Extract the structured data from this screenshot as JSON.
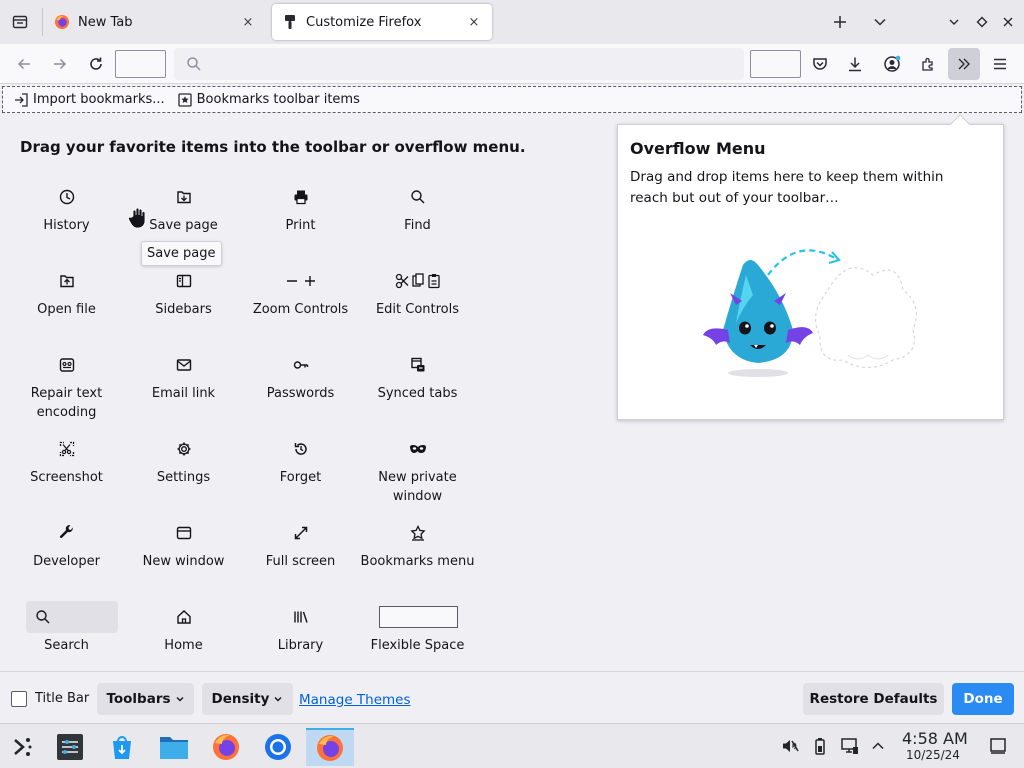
{
  "tabs": [
    {
      "label": "New Tab",
      "icon": "firefox-icon",
      "active": false
    },
    {
      "label": "Customize Firefox",
      "icon": "paintbrush-icon",
      "active": true
    }
  ],
  "tab_close_glyph": "×",
  "bookmarks_toolbar": {
    "import_label": "Import bookmarks...",
    "items_label": "Bookmarks toolbar items"
  },
  "palette": {
    "title": "Drag your favorite items into the toolbar or overflow menu.",
    "items": [
      {
        "label": "History",
        "icon": "clock-icon"
      },
      {
        "label": "Save page",
        "icon": "save-page-icon"
      },
      {
        "label": "Print",
        "icon": "printer-icon"
      },
      {
        "label": "Find",
        "icon": "magnifier-icon"
      },
      {
        "label": "Open file",
        "icon": "open-file-icon"
      },
      {
        "label": "Sidebars",
        "icon": "sidebar-icon"
      },
      {
        "label": "Zoom Controls",
        "icon": "zoom-icon"
      },
      {
        "label": "Edit Controls",
        "icon": "edit-controls-icon"
      },
      {
        "label": "Repair text encoding",
        "icon": "text-encoding-icon"
      },
      {
        "label": "Email link",
        "icon": "envelope-icon"
      },
      {
        "label": "Passwords",
        "icon": "key-icon"
      },
      {
        "label": "Synced tabs",
        "icon": "synced-tabs-icon"
      },
      {
        "label": "Screenshot",
        "icon": "screenshot-icon"
      },
      {
        "label": "Settings",
        "icon": "gear-icon"
      },
      {
        "label": "Forget",
        "icon": "forget-icon"
      },
      {
        "label": "New private window",
        "icon": "private-mask-icon"
      },
      {
        "label": "Developer",
        "icon": "wrench-icon"
      },
      {
        "label": "New window",
        "icon": "window-icon"
      },
      {
        "label": "Full screen",
        "icon": "fullscreen-icon"
      },
      {
        "label": "Bookmarks menu",
        "icon": "bookmark-star-icon"
      },
      {
        "label": "Search",
        "icon": "search-icon"
      },
      {
        "label": "Home",
        "icon": "home-icon"
      },
      {
        "label": "Library",
        "icon": "library-icon"
      },
      {
        "label": "Flexible Space",
        "icon": "flexible-space-icon"
      }
    ],
    "tooltip": "Save page"
  },
  "overflow_menu": {
    "title": "Overflow Menu",
    "description": "Drag and drop items here to keep them within reach but out of your toolbar…"
  },
  "footer": {
    "title_bar_label": "Title Bar",
    "title_bar_checked": false,
    "toolbars_label": "Toolbars",
    "density_label": "Density",
    "manage_themes_label": "Manage Themes",
    "restore_defaults_label": "Restore Defaults",
    "done_label": "Done"
  },
  "taskbar": {
    "apps": [
      "application-launcher-icon",
      "system-settings-icon",
      "discover-store-icon",
      "file-manager-icon",
      "firefox-icon",
      "chromium-icon",
      "firefox-active-icon"
    ],
    "time": "4:58 AM",
    "date": "10/25/24"
  },
  "colors": {
    "accent": "#0061e0",
    "done_button": "#2a8bf2",
    "overflow_button_bg": "#cfcfd8",
    "chrome_bg": "#f0f0f4"
  }
}
